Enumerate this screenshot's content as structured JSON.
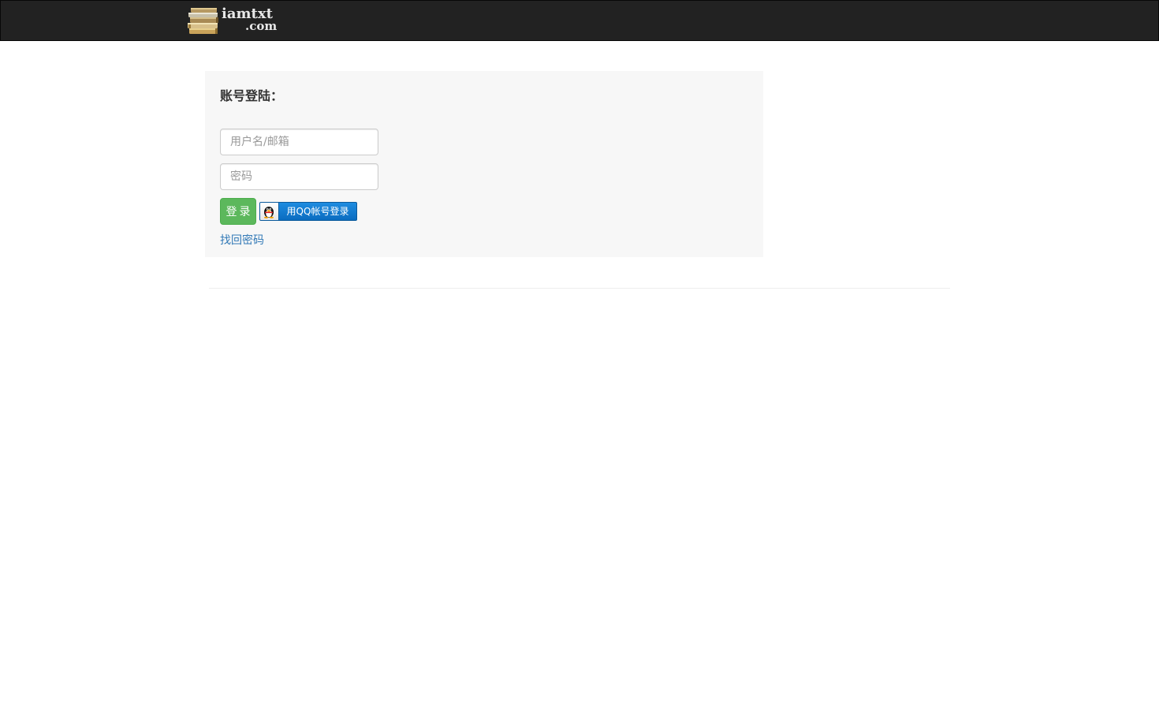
{
  "header": {
    "logo_main": "iamtxt",
    "logo_sub": ".com",
    "logo_icon": "books-stack-icon",
    "background": "#222222"
  },
  "login": {
    "title": "账号登陆：",
    "username_placeholder": "用户名/邮箱",
    "password_placeholder": "密码",
    "login_button": "登录",
    "qq_button": "用QQ帐号登录",
    "qq_icon": "qq-penguin-icon",
    "forgot_password": "找回密码",
    "login_button_color": "#5cb85c",
    "link_color": "#337ab7"
  }
}
